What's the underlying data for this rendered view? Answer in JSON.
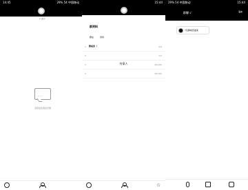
{
  "panel1": {
    "time": "14:45",
    "status_right": "29% 54 中国移动",
    "header_label": "0 提示",
    "empty_text": "没有最近消息记录",
    "empty_dots": "...",
    "nav": {
      "left_icon": "chat-icon",
      "right_icon": "user-icon"
    }
  },
  "panel2": {
    "time": "15:44",
    "title": "群资料",
    "field_key": "群主",
    "field_value": "群聊",
    "items": [
      {
        "num": "1",
        "name": "群成员（",
        "count": "0/5"
      },
      {
        "num": "2",
        "name": "",
        "count": "0/?"
      },
      {
        "num": "3",
        "name": "",
        "count": "50/100"
      },
      {
        "num": "4",
        "name": "",
        "count": "50/100"
      }
    ],
    "center_text": "共享人",
    "nav": {
      "left_icon": "chat-icon",
      "mid_icon": "user-icon",
      "right_icon": "star-icon"
    }
  },
  "panel3": {
    "time": "15:44",
    "title": "群聊 √",
    "right_label": "语言",
    "sub_label": "0 提示",
    "status_right": "29% 54 中国移动",
    "bubble_text": "7位群成员发来",
    "tools": [
      "mic-icon",
      "image-icon",
      "camera-icon"
    ]
  }
}
